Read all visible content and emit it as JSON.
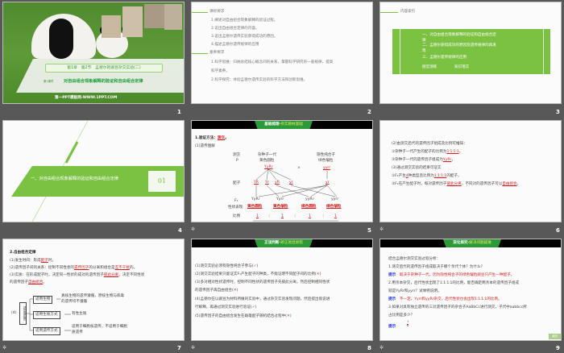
{
  "slides": [
    {
      "number": "1",
      "chapter_title": "第1章　第2节　孟德尔的豌豆杂交实验(二)",
      "lesson_tag": "第1课时",
      "subtitle": "对自由组合现象解释的验证和自由组合定律",
      "watermark": "第一PPT模板网-WWW.1PPT.COM"
    },
    {
      "number": "2",
      "section1": "课标要求",
      "items1": [
        "1.阐述对自由组合现象解释的验证过程。",
        "2.说出自由组合定律的内容。",
        "3.说出孟德尔遗传实验获得成功的原因。",
        "4.描述孟德尔遗传规律的应用"
      ],
      "section2": "素养要求",
      "items2": [
        "1.科学思维：归纳总结核心概念间的关系，掌握科学研究的一般规律，提高",
        "科学素养。",
        "2.科学探究：体验孟德尔遗传实验的科学方法和创新思维。"
      ]
    },
    {
      "number": "3",
      "title": "内容索引",
      "items": [
        "一、对自由组合现象解释的验证和自由组合定",
        "律",
        "二、孟德尔获得成功的原因及遗传规律的再发",
        "现",
        "三、孟德尔遗传规律的应用"
      ],
      "footer_left": "随堂演练",
      "footer_right": "知识落实"
    },
    {
      "number": "4",
      "section_title": "一、对自由组合现象解释的验证和自由组合定律",
      "section_no": "01"
    },
    {
      "number": "5",
      "header_a": "基础梳理·",
      "header_b": "夯实教材基础",
      "line1_prefix": "1.验证方法：",
      "line1_answer": "测交",
      "line1_suffix": "。",
      "line2": "(1)遗传图解",
      "cross_label": "测交",
      "p_label": "P",
      "parent1_a": "杂种子一代",
      "parent1_b": "黄色圆粒",
      "parent2_a": "隐性纯合子",
      "parent2_b": "绿色皱粒",
      "times": "×",
      "parent1_geno": "YyRr",
      "parent2_geno": "yyrr",
      "gamete_label": "配子",
      "gametes1": [
        "YR",
        "Yr",
        "yR",
        "yr"
      ],
      "gamete2": "yr",
      "f1_label": "F₁",
      "f1": [
        "YyRr",
        "Yyrr",
        "yyRr",
        "yyrr"
      ],
      "phen_label": "性状表现",
      "phen": [
        "黄色圆粒",
        "黄色皱粒",
        "绿色圆粒",
        "绿色皱粒"
      ],
      "ratio_label": "比例",
      "ratio": [
        "1",
        "：",
        "1",
        "：",
        "1",
        "：",
        "1"
      ]
    },
    {
      "number": "6",
      "lines": [
        {
          "t": "(2)由测交后代的遗传因子组成及比例可推知："
        },
        {
          "t": "①杂种子一代产生的配子的比例为",
          "a": "1∶1∶1∶1",
          "s": "。"
        },
        {
          "t": "②杂种子一代的遗传因子组成为",
          "a": "YyRr",
          "s": "。"
        },
        {
          "t": "(3)通过测交实验的结果可证实"
        },
        {
          "t": "①F₁产生",
          "a": "4",
          "s": "种类型且比例为",
          "a2": "1∶1∶1∶1",
          "s2": "的配子。"
        },
        {
          "t": "②F₁在产生配子时，每对遗传因子",
          "a": "彼此分离",
          "s": "，不同对的遗传因子可以",
          "a2": "自由组合",
          "s2": "。"
        }
      ]
    },
    {
      "number": "7",
      "title": "2.自由组合定律",
      "l1": "(1)发生时间：形成",
      "l1a": "配子",
      "l1s": "时。",
      "l2": "(2)遗传因子间的关系：控制不同性状的",
      "l2a": "遗传因子",
      "l2m": "的分离和组合是",
      "l2b": "互不干扰",
      "l2s": "的。",
      "l3": "(3)实质：在形成配子时，决定同一性状的成对的遗传因子",
      "l3a": "彼此分离",
      "l3s": "，决定不同性状",
      "l4": "的遗传因子",
      "l4a": "自由组合",
      "l4s": "。",
      "l5": "(4)",
      "box": "适用范围",
      "branches": [
        {
          "k": "适用生物",
          "v1": "真核生物的遗传遵循，原核生物与病毒",
          "v2": "的遗传均不遵循"
        },
        {
          "k": "适用生殖方式",
          "v1": "有性生殖",
          "v2": ""
        },
        {
          "k": "适用遗传方式",
          "v1": "适用于细胞核遗传，不适用于细胞",
          "v2": "质遗传"
        }
      ]
    },
    {
      "number": "8",
      "header_a": "正误判断·",
      "header_b": "矫正易混易错",
      "lines": [
        {
          "t": "(1)测交实验必须有隐性纯合子参与(",
          "m": "✓",
          "s": ")"
        },
        {
          "t": "(2)测交实验结果只能证实F₁产生配子的种类，不能证明不同配子间的比例(",
          "m": "✕",
          "s": ")"
        },
        {
          "t": "(3)多对相对性状遗传时，控制不同性状的遗传因子先彼此分离，然后控制相同性状"
        },
        {
          "t": "的遗传因子再自由组合(",
          "m": "✕",
          "s": ")"
        },
        {
          "t": "(4)孟德尔在以豌豆为材料所做的实验中，通过杂交实验发现问题，然后提出假说进"
        },
        {
          "t": "行解释，再通过测交实验进行验证(",
          "m": "✓",
          "s": ")"
        },
        {
          "t": "(5)遗传因子的自由组合发生在雌雄配子随机结合过程中(",
          "m": "✕",
          "s": ")"
        }
      ]
    },
    {
      "number": "9",
      "header_a": "深化探究·",
      "header_b": "解决问题疑难",
      "intro": "结合孟德尔测交实验过程分析：",
      "q1": "1.测交后代的遗传因子组成取决于哪个亲代个体？为什么？",
      "hint": "提示",
      "a1": "取决于杂种子一代，因为隐性纯合子的绿色皱粒豌豆只产生一种配子。",
      "q2a": "2.用亲本杂交，后代性状出现了1∶1∶1∶1的比例，能否确定两亲本的遗传因子组成",
      "q2b": "就是YyRr和yyrr？试举例说明。",
      "a2": "不一定。Yyrr和yyRr杂交，后代性状也会出现1∶1∶1∶1的比例。",
      "q3a": "3.如果对具有独立遗传的三对遗传因子的杂合子AaBbCc进行测交，子代中aabbcc所",
      "q3b": "占比例是多少？",
      "a3_num": "1",
      "a3_den": "8",
      "back": "返回"
    }
  ],
  "colors": {
    "accent": "#7cc242",
    "background": "#585858",
    "answer": "#d42020"
  }
}
